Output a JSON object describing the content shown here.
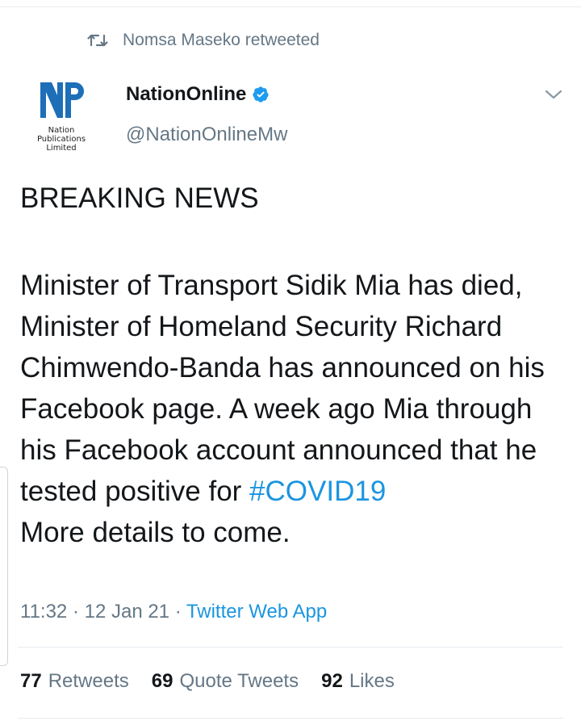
{
  "retweet": {
    "label": "Nomsa Maseko retweeted",
    "icon": "retweet-icon"
  },
  "author": {
    "name": "NationOnline",
    "handle": "@NationOnlineMw",
    "logo_text": "NP",
    "logo_caption": [
      "Nation",
      "Publications",
      "Limited"
    ],
    "verified": true
  },
  "tweet": {
    "headline": "BREAKING NEWS",
    "body": "Minister of Transport Sidik Mia has died, Minister of Homeland Security Richard Chimwendo-Banda has announced on his Facebook page. A week ago Mia through his Facebook account announced that he tested positive for ",
    "hashtag": "#COVID19",
    "closing": "More details to come.",
    "time": "11:32 · 12 Jan 21 · ",
    "source": "Twitter Web App"
  },
  "stats": {
    "retweets_count": "77",
    "retweets_label": "Retweets",
    "quotes_count": "69",
    "quotes_label": "Quote Tweets",
    "likes_count": "92",
    "likes_label": "Likes"
  },
  "colors": {
    "accent": "#1b95e0",
    "secondary_text": "#657786",
    "logo_blue": "#1d6fb8"
  }
}
